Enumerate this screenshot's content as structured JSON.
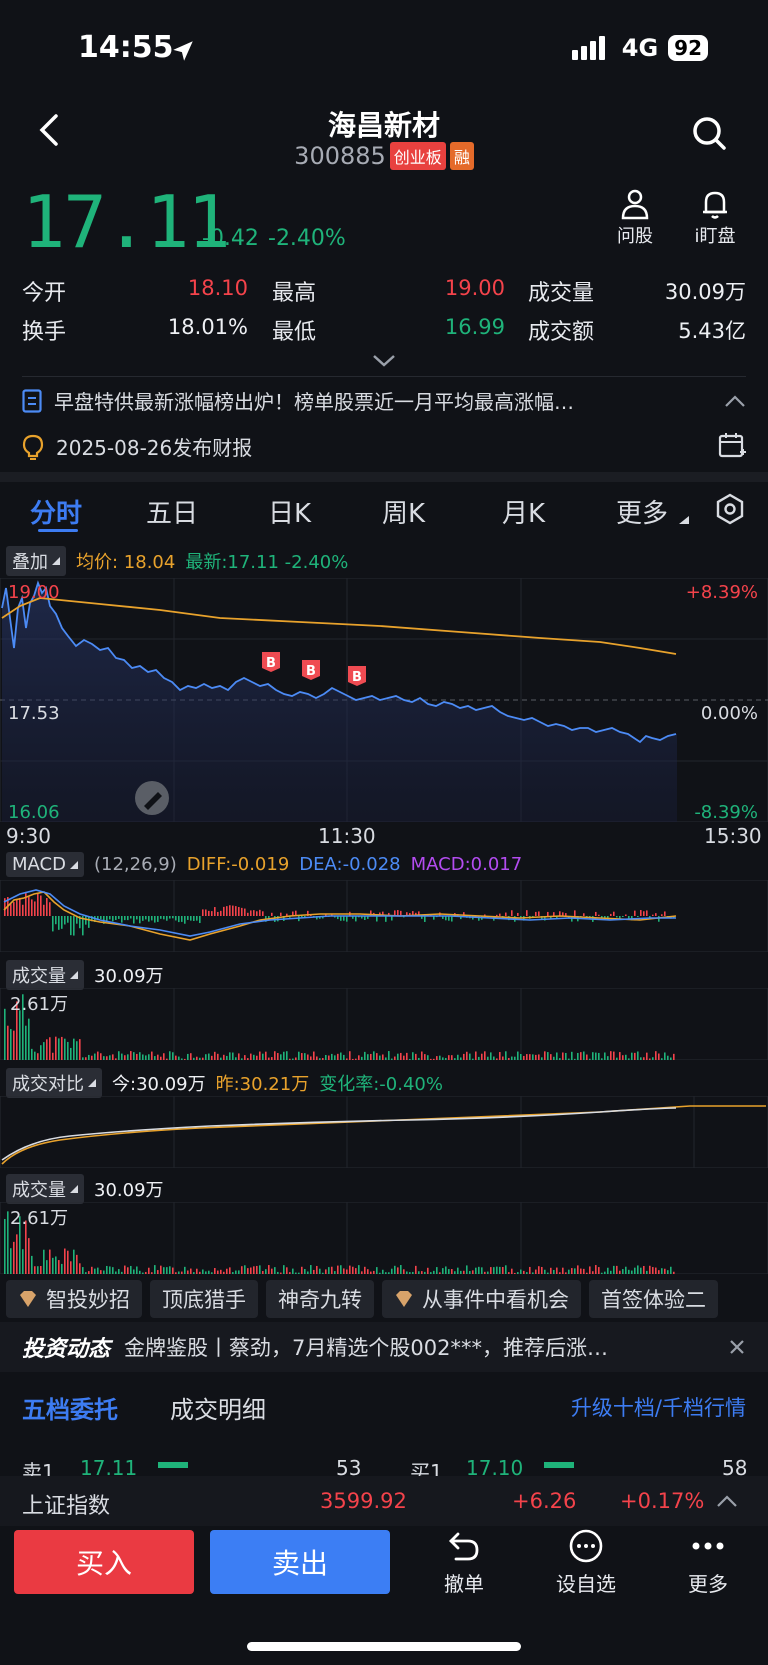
{
  "status": {
    "time": "14:55",
    "network": "4G",
    "battery": "92"
  },
  "header": {
    "name": "海昌新材",
    "code": "300885",
    "tag_board": "创业板",
    "tag_margin": "融"
  },
  "quote": {
    "price": "17.11",
    "change": "-0.42",
    "change_pct": "-2.40%",
    "actions": [
      {
        "label": "问股"
      },
      {
        "label": "i盯盘"
      }
    ],
    "stats": {
      "open_label": "今开",
      "open": "18.10",
      "high_label": "最高",
      "high": "19.00",
      "vol_label": "成交量",
      "vol": "30.09万",
      "turnover_label": "换手",
      "turnover": "18.01%",
      "low_label": "最低",
      "low": "16.99",
      "amount_label": "成交额",
      "amount": "5.43亿"
    }
  },
  "news": {
    "headline": "早盘特供最新涨幅榜出炉！榜单股票近一月平均最高涨幅…",
    "report": "2025-08-26发布财报"
  },
  "tabs": [
    "分时",
    "五日",
    "日K",
    "周K",
    "月K",
    "更多"
  ],
  "main_chart": {
    "overlay_label": "叠加",
    "avg_label": "均价: 18.04",
    "latest_label": "最新:17.11 -2.40%",
    "y_top": "19.00",
    "y_mid": "17.53",
    "y_bot": "16.06",
    "pct_top": "+8.39%",
    "pct_mid": "0.00%",
    "pct_bot": "-8.39%",
    "x_start": "9:30",
    "x_mid": "11:30",
    "x_end": "15:30",
    "buy_marker": "B"
  },
  "macd": {
    "label": "MACD",
    "params": "(12,26,9)",
    "diff": "DIFF:-0.019",
    "dea": "DEA:-0.028",
    "macd": "MACD:0.017"
  },
  "volume1": {
    "label": "成交量",
    "value": "30.09万",
    "axis_max": "2.61万"
  },
  "compare": {
    "label": "成交对比",
    "today": "今:30.09万",
    "yesterday": "昨:30.21万",
    "change": "变化率:-0.40%"
  },
  "volume2": {
    "label": "成交量",
    "value": "30.09万",
    "axis_max": "2.61万"
  },
  "pills": [
    "智投妙招",
    "顶底猎手",
    "神奇九转",
    "从事件中看机会",
    "首签体验二"
  ],
  "invest_news": {
    "label": "投资动态",
    "text": "金牌鉴股丨蔡劲，7月精选个股002***，推荐后涨…"
  },
  "order_tabs": {
    "five": "五档委托",
    "detail": "成交明细",
    "upgrade": "升级十档/千档行情"
  },
  "order_row": {
    "sell_label": "卖1",
    "sell_price": "17.11",
    "sell_qty": "53",
    "buy_label": "买1",
    "buy_price": "17.10",
    "buy_qty": "58"
  },
  "index_bar": {
    "name": "上证指数",
    "value": "3599.92",
    "change": "+6.26",
    "pct": "+0.17%"
  },
  "bottom": {
    "buy": "买入",
    "sell": "卖出",
    "cancel": "撤单",
    "watch": "设自选",
    "more": "更多"
  }
}
